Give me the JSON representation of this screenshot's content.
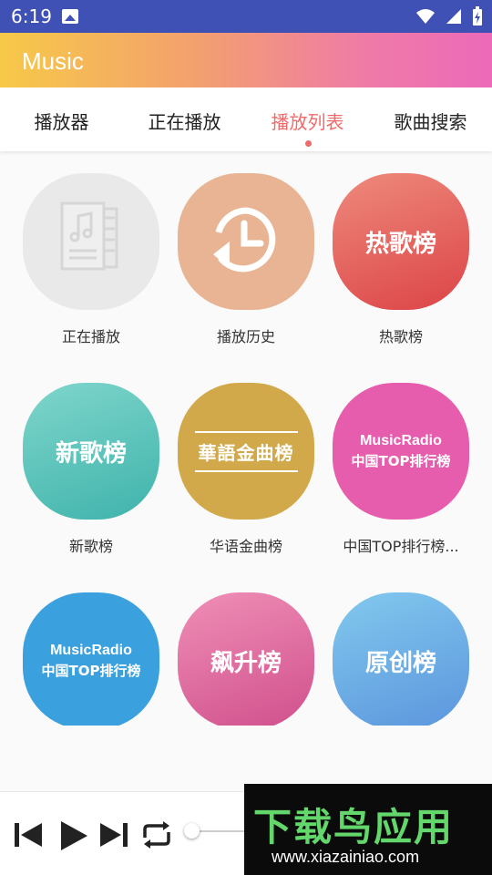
{
  "status_bar": {
    "time": "6:19"
  },
  "app_bar": {
    "title": "Music"
  },
  "tabs": [
    {
      "label": "播放器"
    },
    {
      "label": "正在播放"
    },
    {
      "label": "播放列表"
    },
    {
      "label": "歌曲搜索"
    }
  ],
  "active_tab": "播放列表",
  "grid": [
    {
      "label": "正在播放",
      "icon": "music-doc-icon",
      "color": "#e9e9e9"
    },
    {
      "label": "播放历史",
      "icon": "history-icon",
      "color": "#e8b493"
    },
    {
      "label": "热歌榜",
      "badge": "热歌榜",
      "color": "#e4585a"
    },
    {
      "label": "新歌榜",
      "badge": "新歌榜",
      "color": "#4bbfb5"
    },
    {
      "label": "华语金曲榜",
      "badge": "華語金曲榜",
      "color": "#d2a94a"
    },
    {
      "label": "中国TOP排行榜...",
      "badge_line1": "MusicRadio",
      "badge_line2": "中国TOP排行榜",
      "color": "#e65dae"
    },
    {
      "label": "",
      "badge_line1": "MusicRadio",
      "badge_line2": "中国TOP排行榜",
      "color": "#3aa0de"
    },
    {
      "label": "",
      "badge": "飙升榜",
      "color": "#e0649e"
    },
    {
      "label": "",
      "badge": "原创榜",
      "color": "#64a8e3"
    }
  ],
  "player": {
    "progress": 0
  },
  "watermark": {
    "title": "下载鸟应用",
    "url": "www.xiazainiao.com"
  }
}
